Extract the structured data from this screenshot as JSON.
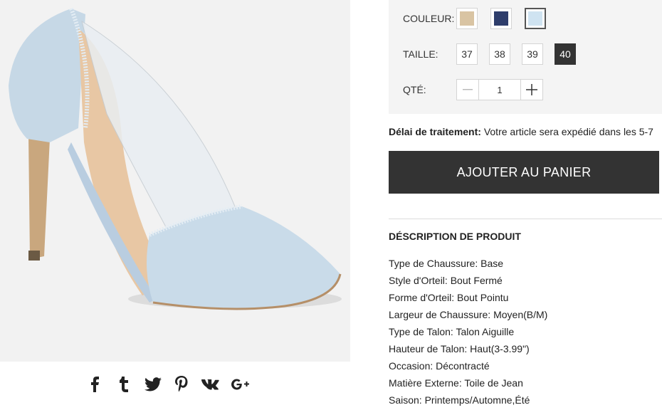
{
  "colors": {
    "swatches": [
      "#d9c4a3",
      "#2e3d6b",
      "#cfe3f1"
    ],
    "dark_button": "#333333",
    "panel_bg": "#f4f4f4"
  },
  "options": {
    "color_label": "COULEUR:",
    "size_label": "TAILLE:",
    "sizes": [
      "37",
      "38",
      "39",
      "40"
    ],
    "selected_size": "40",
    "qty_label": "QTÉ:",
    "qty_value": "1"
  },
  "processing": {
    "label": "Délai de traitement:",
    "text": " Votre article sera expédié dans les 5-7"
  },
  "cart_button": "AJOUTER AU PANIER",
  "description": {
    "title": "DÉSCRIPTION DE PRODUIT",
    "items": [
      "Type de Chaussure: Base",
      "Style d'Orteil: Bout Fermé",
      "Forme d'Orteil: Bout Pointu",
      "Largeur de Chaussure: Moyen(B/M)",
      "Type de Talon: Talon Aiguille",
      "Hauteur de Talon: Haut(3-3.99\")",
      "Occasion: Décontracté",
      "Matière Externe: Toile de Jean",
      "Saison: Printemps/Automne,Été"
    ]
  },
  "social": {
    "icons": [
      "facebook-icon",
      "tumblr-icon",
      "twitter-icon",
      "pinterest-icon",
      "vk-icon",
      "google-plus-icon"
    ],
    "glyphs": [
      "f",
      "t",
      "",
      "",
      "vk",
      "G+"
    ]
  }
}
